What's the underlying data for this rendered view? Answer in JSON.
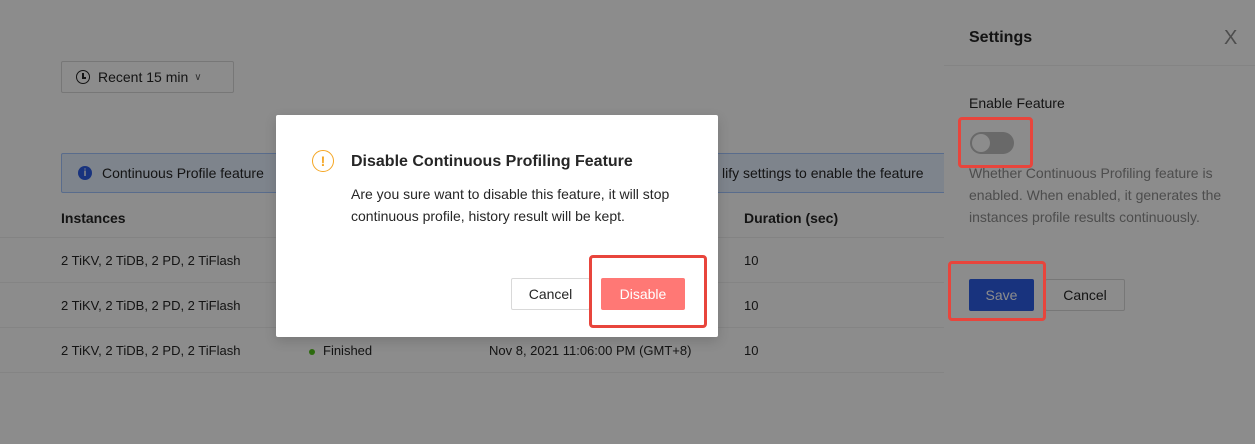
{
  "page": {
    "range_picker_label": "Recent 15 min",
    "alert_text": "Continuous Profile feature",
    "alert_tail": "lify settings to enable the feature",
    "columns": [
      "Instances",
      "Duration (sec)"
    ],
    "rows": [
      {
        "instances": "2 TiKV, 2 TiDB, 2 PD, 2 TiFlash",
        "status": "",
        "start": "",
        "duration": "10"
      },
      {
        "instances": "2 TiKV, 2 TiDB, 2 PD, 2 TiFlash",
        "status": "",
        "start": "",
        "duration": "10"
      },
      {
        "instances": "2 TiKV, 2 TiDB, 2 PD, 2 TiFlash",
        "status": "Finished",
        "start": "Nov 8, 2021 11:06:00 PM (GMT+8)",
        "duration": "10"
      }
    ]
  },
  "modal": {
    "title": "Disable Continuous Profiling Feature",
    "body": "Are you sure want to disable this feature, it will stop continuous profile, history result will be kept.",
    "cancel_label": "Cancel",
    "disable_label": "Disable"
  },
  "drawer": {
    "title": "Settings",
    "close_glyph": "X",
    "field_label": "Enable Feature",
    "toggle_on": false,
    "help_text": "Whether Continuous Profiling feature is enabled. When enabled, it generates the instances profile results continuously.",
    "save_label": "Save",
    "cancel_label": "Cancel"
  },
  "colors": {
    "primary": "#2d5de6",
    "danger": "#ff7875",
    "warning": "#f5a623",
    "success": "#52c41a",
    "highlight": "#e8453c"
  }
}
